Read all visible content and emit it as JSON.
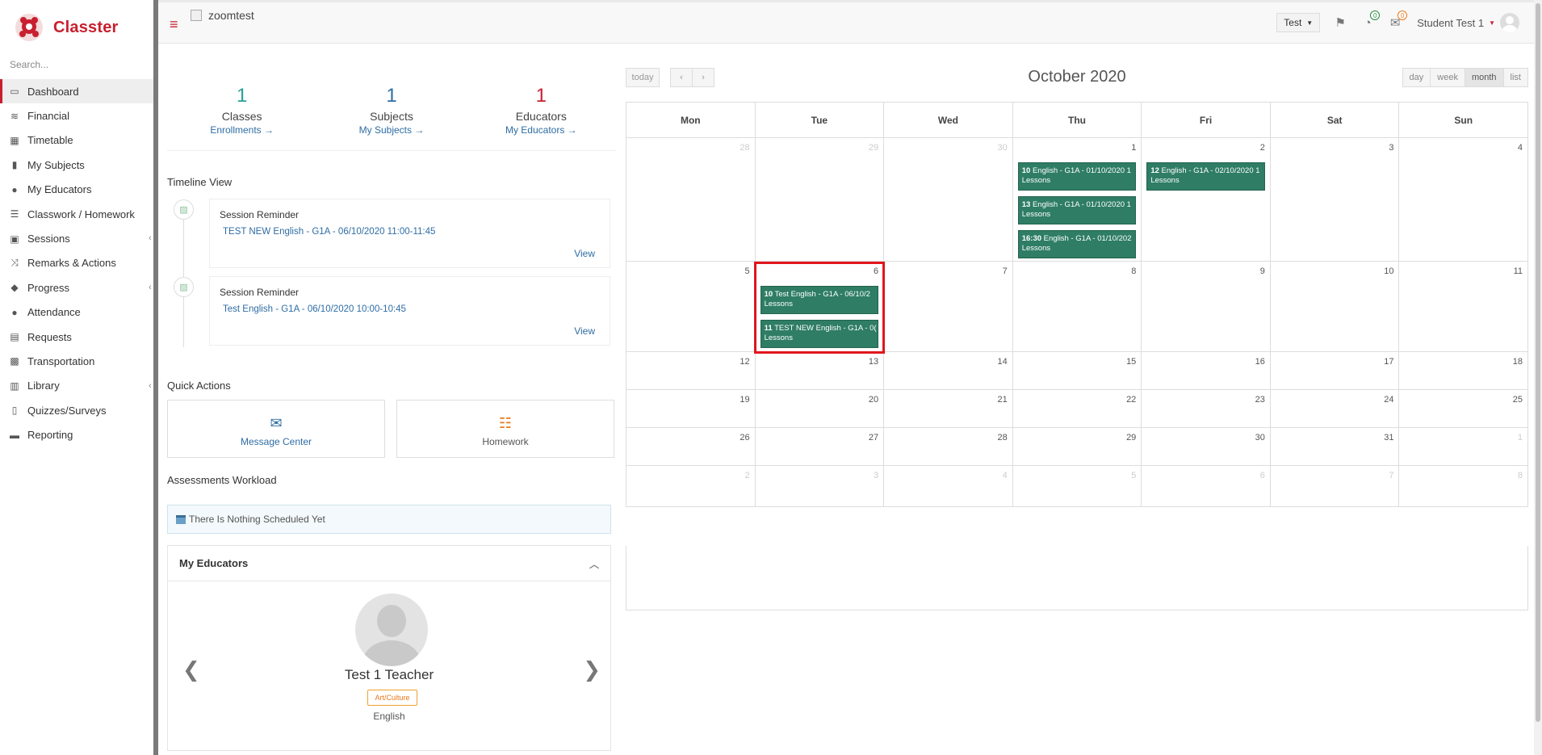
{
  "sidebar": {
    "logo_text": "Classter",
    "search_placeholder": "Search...",
    "items": [
      {
        "label": "Dashboard",
        "icon": "laptop-icon"
      },
      {
        "label": "Financial",
        "icon": "coins-icon"
      },
      {
        "label": "Timetable",
        "icon": "calendar-icon"
      },
      {
        "label": "My Subjects",
        "icon": "book-icon"
      },
      {
        "label": "My Educators",
        "icon": "users-icon"
      },
      {
        "label": "Classwork / Homework",
        "icon": "tasks-icon"
      },
      {
        "label": "Sessions",
        "icon": "projector-icon"
      },
      {
        "label": "Remarks & Actions",
        "icon": "shuffle-icon"
      },
      {
        "label": "Progress",
        "icon": "graduation-cap-icon"
      },
      {
        "label": "Attendance",
        "icon": "user-check-icon"
      },
      {
        "label": "Requests",
        "icon": "request-icon"
      },
      {
        "label": "Transportation",
        "icon": "bus-icon"
      },
      {
        "label": "Library",
        "icon": "library-icon"
      },
      {
        "label": "Quizzes/Surveys",
        "icon": "quiz-icon"
      },
      {
        "label": "Reporting",
        "icon": "printer-icon"
      }
    ]
  },
  "topbar": {
    "brand_alt": "zoomtest",
    "test_dropdown": "Test",
    "notif_count": "0",
    "mail_count": "0",
    "user_name": "Student Test 1"
  },
  "stats": [
    {
      "num": "1",
      "label": "Classes",
      "link": "Enrollments  →"
    },
    {
      "num": "1",
      "label": "Subjects",
      "link": "My Subjects  →"
    },
    {
      "num": "1",
      "label": "Educators",
      "link": "My Educators  →"
    }
  ],
  "timeline": {
    "title": "Timeline View",
    "items": [
      {
        "title": "Session Reminder",
        "subtitle": "TEST NEW English - G1A - 06/10/2020 11:00-11:45",
        "view": "View"
      },
      {
        "title": "Session Reminder",
        "subtitle": "Test English - G1A - 06/10/2020 10:00-10:45",
        "view": "View"
      }
    ]
  },
  "quick_actions": {
    "title": "Quick Actions",
    "message_center": "Message Center",
    "homework": "Homework"
  },
  "assessments": {
    "title": "Assessments Workload",
    "empty": "There Is Nothing Scheduled Yet"
  },
  "educators": {
    "title": "My Educators",
    "name": "Test 1 Teacher",
    "tag": "Art/Culture",
    "subject": "English"
  },
  "calendar": {
    "today": "today",
    "prev": "‹",
    "next": "›",
    "title": "October 2020",
    "views": [
      "day",
      "week",
      "month",
      "list"
    ],
    "active_view": "month",
    "weekdays": [
      "Mon",
      "Tue",
      "Wed",
      "Thu",
      "Fri",
      "Sat",
      "Sun"
    ],
    "weeks": [
      [
        "28",
        "29",
        "30",
        "1",
        "2",
        "3",
        "4"
      ],
      [
        "5",
        "6",
        "7",
        "8",
        "9",
        "10",
        "11"
      ],
      [
        "12",
        "13",
        "14",
        "15",
        "16",
        "17",
        "18"
      ],
      [
        "19",
        "20",
        "21",
        "22",
        "23",
        "24",
        "25"
      ],
      [
        "26",
        "27",
        "28",
        "29",
        "30",
        "31",
        "1"
      ],
      [
        "2",
        "3",
        "4",
        "5",
        "6",
        "7",
        "8"
      ]
    ],
    "events": {
      "thu1_a": {
        "time": "10",
        "text": " English - G1A - 01/10/2020 1",
        "sub": "Lessons"
      },
      "thu1_b": {
        "time": "13",
        "text": " English - G1A - 01/10/2020 1",
        "sub": "Lessons"
      },
      "thu1_c": {
        "time": "16:30",
        "text": " English - G1A - 01/10/202",
        "sub": "Lessons"
      },
      "fri2_a": {
        "time": "12",
        "text": " English - G1A - 02/10/2020 1",
        "sub": "Lessons"
      },
      "tue6_a": {
        "time": "10",
        "text": " Test English - G1A - 06/10/2",
        "sub": "Lessons"
      },
      "tue6_b": {
        "time": "11",
        "text": " TEST NEW English - G1A - 0(",
        "sub": "Lessons"
      }
    },
    "event_color": "#2e7d64",
    "highlight_color": "#e0161c"
  }
}
